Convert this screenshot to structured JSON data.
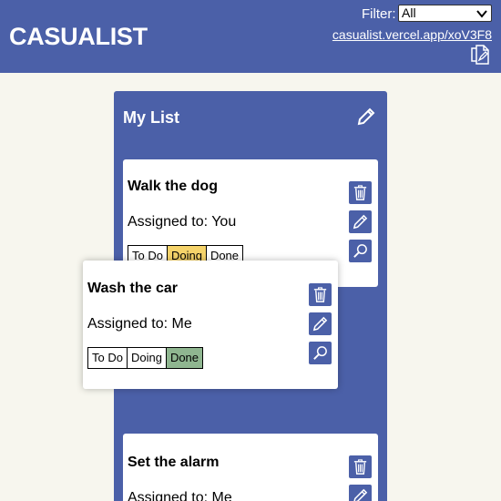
{
  "app": {
    "title": "CASUALIST",
    "filter_label": "Filter:",
    "filter_value": "All",
    "share_link": "casualist.vercel.app/xoV3F8"
  },
  "list": {
    "title": "My List",
    "cards": [
      {
        "title": "Walk the dog",
        "assigned": "Assigned to: You",
        "status": "Doing"
      },
      {
        "title": "Wash the car",
        "assigned": "Assigned to: Me",
        "status": "Done"
      },
      {
        "title": "Set the alarm",
        "assigned": "Assigned to: Me",
        "status": ""
      }
    ]
  },
  "status_labels": [
    "To Do",
    "Doing",
    "Done"
  ],
  "colors": {
    "header": "#4b60a8",
    "background": "#f7f6ee",
    "doing": "#f5d36a",
    "done": "#8fb690"
  },
  "icons": [
    "copy-link-icon",
    "pencil-icon",
    "trash-icon",
    "magnifier-icon",
    "chevron-down-icon"
  ]
}
